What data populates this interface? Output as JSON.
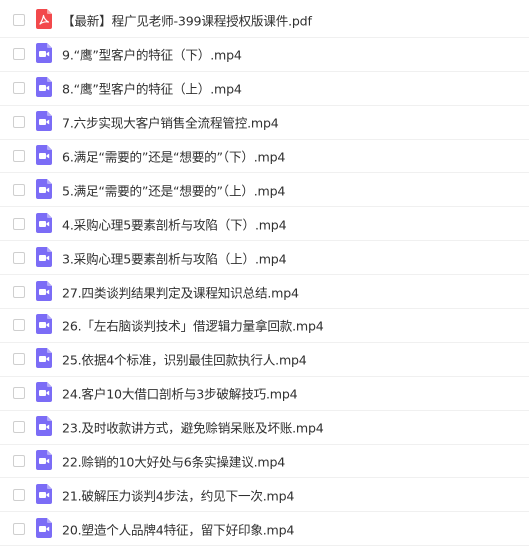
{
  "colors": {
    "pdf_icon": "#f2494c",
    "video_icon": "#7b6cf6",
    "text": "#303030",
    "checkbox_border": "#cfcfcf"
  },
  "files": [
    {
      "name": "【最新】程广见老师-399课程授权版课件.pdf",
      "icon": "pdf-icon"
    },
    {
      "name": "9.“鹰”型客户的特征（下）.mp4",
      "icon": "video-icon"
    },
    {
      "name": "8.“鹰”型客户的特征（上）.mp4",
      "icon": "video-icon"
    },
    {
      "name": "7.六步实现大客户销售全流程管控.mp4",
      "icon": "video-icon"
    },
    {
      "name": "6.满足“需要的”还是“想要的”（下）.mp4",
      "icon": "video-icon"
    },
    {
      "name": "5.满足“需要的”还是“想要的”（上）.mp4",
      "icon": "video-icon"
    },
    {
      "name": "4.采购心理5要素剖析与攻陷（下）.mp4",
      "icon": "video-icon"
    },
    {
      "name": "3.采购心理5要素剖析与攻陷（上）.mp4",
      "icon": "video-icon"
    },
    {
      "name": "27.四类谈判结果判定及课程知识总结.mp4",
      "icon": "video-icon"
    },
    {
      "name": "26.「左右脑谈判技术」借逻辑力量拿回款.mp4",
      "icon": "video-icon"
    },
    {
      "name": "25.依据4个标准，识别最佳回款执行人.mp4",
      "icon": "video-icon"
    },
    {
      "name": "24.客户10大借口剖析与3步破解技巧.mp4",
      "icon": "video-icon"
    },
    {
      "name": "23.及时收款讲方式，避免赊销呆账及坏账.mp4",
      "icon": "video-icon"
    },
    {
      "name": "22.赊销的10大好处与6条实操建议.mp4",
      "icon": "video-icon"
    },
    {
      "name": "21.破解压力谈判4步法，约见下一次.mp4",
      "icon": "video-icon"
    },
    {
      "name": "20.塑造个人品牌4特征，留下好印象.mp4",
      "icon": "video-icon"
    }
  ]
}
